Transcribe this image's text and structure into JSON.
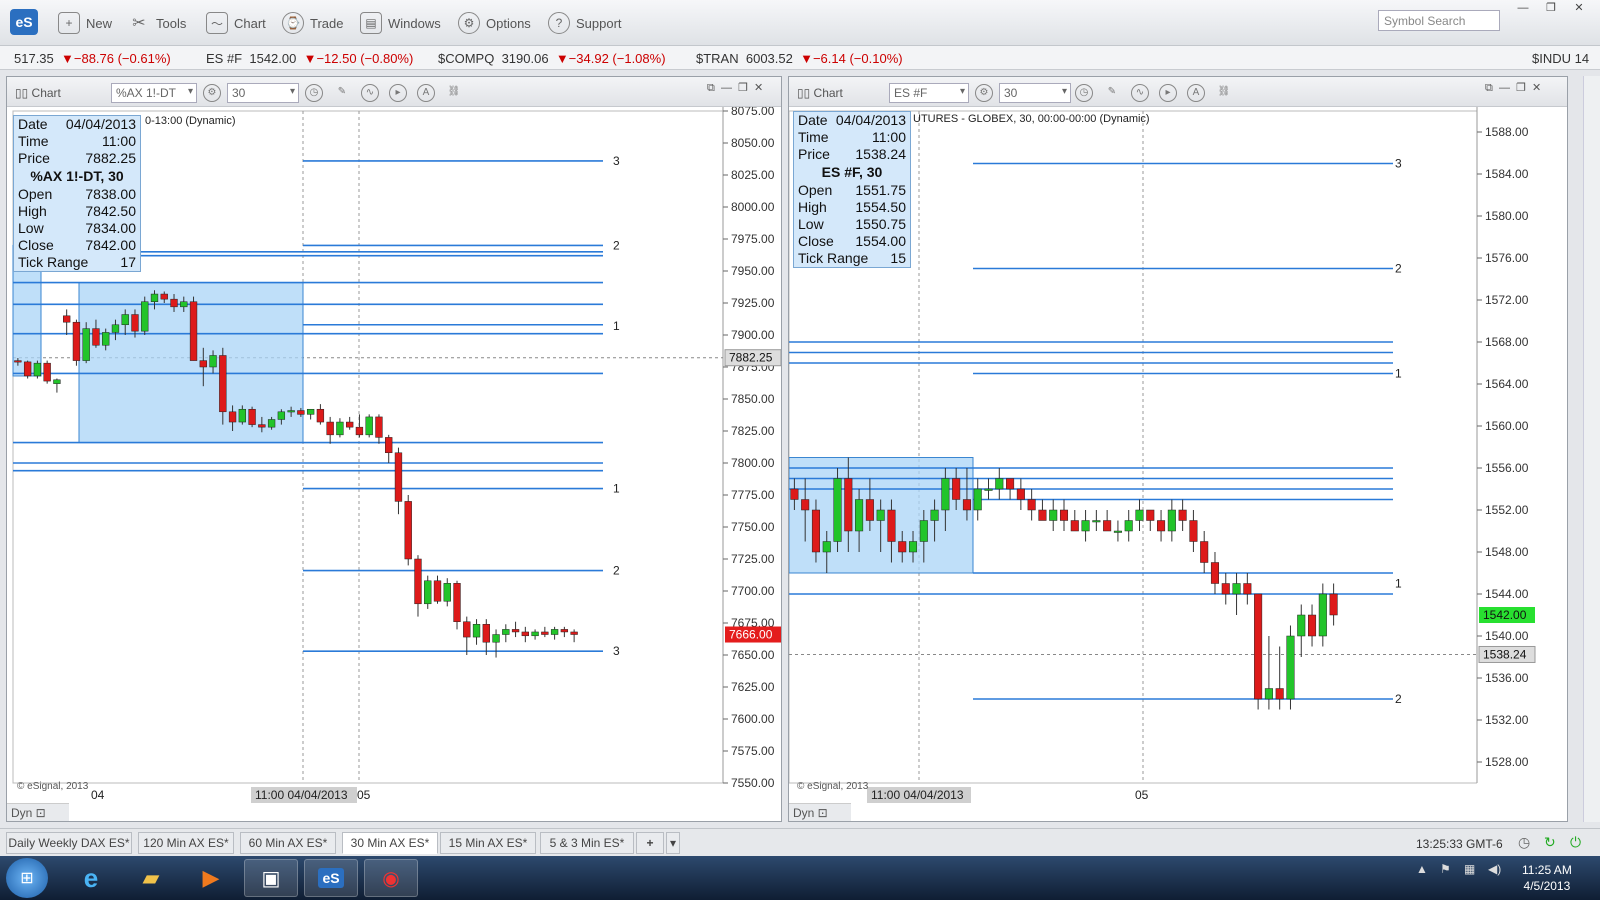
{
  "toolbar": {
    "new": "New",
    "tools": "Tools",
    "chart": "Chart",
    "trade": "Trade",
    "windows": "Windows",
    "options": "Options",
    "support": "Support",
    "search_placeholder": "Symbol Search",
    "logo": "eS"
  },
  "ticker": [
    {
      "sym": "517.35",
      "chg": "▼−88.76 (−0.61%)"
    },
    {
      "sym": "ES #F",
      "price": "1542.00",
      "chg": "▼−12.50 (−0.80%)"
    },
    {
      "sym": "$COMPQ",
      "price": "3190.06",
      "chg": "▼−34.92 (−1.08%)"
    },
    {
      "sym": "$TRAN",
      "price": "6003.52",
      "chg": "▼−6.14 (−0.10%)"
    },
    {
      "sym": "$INDU",
      "price": "14"
    }
  ],
  "left": {
    "label": "Chart",
    "symbol": "%AX 1!-DT",
    "interval": "30",
    "subtitle": "0-13:00 (Dynamic)",
    "box": {
      "date_l": "Date",
      "date": "04/04/2013",
      "time_l": "Time",
      "time": "11:00",
      "price_l": "Price",
      "price": "7882.25",
      "head": "%AX 1!-DT, 30",
      "open_l": "Open",
      "open": "7838.00",
      "high_l": "High",
      "high": "7842.50",
      "low_l": "Low",
      "low": "7834.00",
      "close_l": "Close",
      "close": "7842.00",
      "tr_l": "Tick Range",
      "tr": "17"
    },
    "cursor_price": "7882.25",
    "last_price": "7666.00",
    "dyn": "Dyn",
    "esig": "© eSignal, 2013",
    "xlabels": [
      "04",
      "11:00 04/04/2013",
      "05"
    ]
  },
  "right": {
    "label": "Chart",
    "symbol": "ES #F",
    "interval": "30",
    "subtitle": "UTURES - GLOBEX, 30, 00:00-00:00 (Dynamic)",
    "box": {
      "date_l": "Date",
      "date": "04/04/2013",
      "time_l": "Time",
      "time": "11:00",
      "price_l": "Price",
      "price": "1538.24",
      "head": "ES #F, 30",
      "open_l": "Open",
      "open": "1551.75",
      "high_l": "High",
      "high": "1554.50",
      "low_l": "Low",
      "low": "1550.75",
      "close_l": "Close",
      "close": "1554.00",
      "tr_l": "Tick Range",
      "tr": "15"
    },
    "cursor_price": "1538.24",
    "last_price": "1542.00",
    "dyn": "Dyn",
    "esig": "© eSignal, 2013",
    "xlabels": [
      "11:00 04/04/2013",
      "05"
    ]
  },
  "tabs": [
    "Daily Weekly DAX ES*",
    "120 Min AX ES*",
    "60 Min AX ES*",
    "30 Min AX ES*",
    "15 Min AX ES*",
    "5 & 3 Min ES*"
  ],
  "active_tab": 3,
  "status_clock": "13:25:33 GMT-6",
  "taskbar": {
    "time": "11:25 AM",
    "date": "4/5/2013"
  },
  "chart_data": [
    {
      "type": "candlestick",
      "symbol": "%AX 1!-DT",
      "interval": "30",
      "ylim": [
        7550,
        8075
      ],
      "yticks": [
        8075,
        8050,
        8025,
        8000,
        7975,
        7950,
        7925,
        7900,
        7875,
        7850,
        7825,
        7800,
        7775,
        7750,
        7725,
        7700,
        7675,
        7650,
        7625,
        7600,
        7575,
        7550
      ],
      "candles": [
        [
          7880,
          7882,
          7876,
          7879
        ],
        [
          7879,
          7880,
          7866,
          7868
        ],
        [
          7868,
          7880,
          7866,
          7878
        ],
        [
          7878,
          7880,
          7862,
          7864
        ],
        [
          7862,
          7866,
          7855,
          7865
        ],
        [
          7915,
          7920,
          7900,
          7910
        ],
        [
          7910,
          7912,
          7876,
          7880
        ],
        [
          7880,
          7910,
          7878,
          7905
        ],
        [
          7905,
          7912,
          7890,
          7892
        ],
        [
          7892,
          7905,
          7888,
          7902
        ],
        [
          7902,
          7912,
          7896,
          7908
        ],
        [
          7908,
          7920,
          7900,
          7916
        ],
        [
          7916,
          7920,
          7898,
          7903
        ],
        [
          7903,
          7930,
          7900,
          7926
        ],
        [
          7926,
          7935,
          7920,
          7932
        ],
        [
          7932,
          7934,
          7925,
          7928
        ],
        [
          7928,
          7932,
          7918,
          7922
        ],
        [
          7922,
          7930,
          7918,
          7926
        ],
        [
          7926,
          7930,
          7880,
          7880
        ],
        [
          7880,
          7890,
          7860,
          7875
        ],
        [
          7875,
          7888,
          7870,
          7884
        ],
        [
          7884,
          7890,
          7830,
          7840
        ],
        [
          7840,
          7845,
          7825,
          7832
        ],
        [
          7832,
          7845,
          7830,
          7842
        ],
        [
          7842,
          7844,
          7828,
          7830
        ],
        [
          7830,
          7836,
          7824,
          7828
        ],
        [
          7828,
          7836,
          7826,
          7834
        ],
        [
          7834,
          7842,
          7830,
          7840
        ],
        [
          7840,
          7844,
          7836,
          7841
        ],
        [
          7841,
          7843,
          7836,
          7838
        ],
        [
          7838,
          7842,
          7834,
          7842
        ],
        [
          7842,
          7846,
          7830,
          7832
        ],
        [
          7832,
          7836,
          7815,
          7822
        ],
        [
          7822,
          7835,
          7820,
          7832
        ],
        [
          7832,
          7836,
          7826,
          7828
        ],
        [
          7828,
          7838,
          7820,
          7822
        ],
        [
          7822,
          7838,
          7820,
          7836
        ],
        [
          7836,
          7838,
          7815,
          7820
        ],
        [
          7820,
          7822,
          7800,
          7808
        ],
        [
          7808,
          7812,
          7760,
          7770
        ],
        [
          7770,
          7775,
          7720,
          7725
        ],
        [
          7725,
          7728,
          7680,
          7690
        ],
        [
          7690,
          7712,
          7686,
          7708
        ],
        [
          7708,
          7712,
          7690,
          7692
        ],
        [
          7692,
          7710,
          7688,
          7706
        ],
        [
          7706,
          7708,
          7670,
          7676
        ],
        [
          7676,
          7680,
          7650,
          7664
        ],
        [
          7664,
          7678,
          7658,
          7674
        ],
        [
          7674,
          7678,
          7650,
          7660
        ],
        [
          7660,
          7670,
          7648,
          7666
        ],
        [
          7666,
          7674,
          7660,
          7670
        ],
        [
          7670,
          7676,
          7664,
          7668
        ],
        [
          7668,
          7672,
          7660,
          7665
        ],
        [
          7665,
          7670,
          7662,
          7668
        ],
        [
          7668,
          7672,
          7664,
          7666
        ],
        [
          7666,
          7672,
          7662,
          7670
        ],
        [
          7670,
          7672,
          7664,
          7668
        ],
        [
          7668,
          7670,
          7660,
          7666
        ]
      ],
      "level_labels": [
        {
          "text": "3",
          "price": 8036
        },
        {
          "text": "2",
          "price": 7970
        },
        {
          "text": "1",
          "price": 7907
        },
        {
          "text": "1",
          "price": 7780
        },
        {
          "text": "2",
          "price": 7716
        },
        {
          "text": "3",
          "price": 7653
        }
      ],
      "levels": [
        8036,
        7970,
        7965,
        7962,
        7941,
        7924,
        7908,
        7901,
        7870,
        7816,
        7800,
        7794,
        7780,
        7716,
        7653
      ]
    },
    {
      "type": "candlestick",
      "symbol": "ES #F",
      "interval": "30",
      "ylim": [
        1526,
        1590
      ],
      "yticks": [
        1588,
        1584,
        1580,
        1576,
        1572,
        1568,
        1564,
        1560,
        1556,
        1552,
        1548,
        1544,
        1540,
        1536,
        1532,
        1528
      ],
      "candles": [
        [
          1554,
          1555,
          1552,
          1553
        ],
        [
          1553,
          1555,
          1549,
          1552
        ],
        [
          1552,
          1553,
          1547,
          1548
        ],
        [
          1548,
          1550,
          1546,
          1549
        ],
        [
          1549,
          1556,
          1548,
          1555
        ],
        [
          1555,
          1557,
          1548,
          1550
        ],
        [
          1550,
          1554,
          1548,
          1553
        ],
        [
          1553,
          1555,
          1550,
          1551
        ],
        [
          1551,
          1553,
          1548,
          1552
        ],
        [
          1552,
          1553,
          1547,
          1549
        ],
        [
          1549,
          1550,
          1547,
          1548
        ],
        [
          1548,
          1550,
          1547,
          1549
        ],
        [
          1549,
          1552,
          1547,
          1551
        ],
        [
          1551,
          1553,
          1549,
          1552
        ],
        [
          1552,
          1556,
          1550,
          1555
        ],
        [
          1555,
          1556,
          1552,
          1553
        ],
        [
          1553,
          1556,
          1551,
          1552
        ],
        [
          1552,
          1555,
          1551,
          1554
        ],
        [
          1554,
          1555,
          1553,
          1554
        ],
        [
          1554,
          1556,
          1553,
          1555
        ],
        [
          1555,
          1555,
          1553,
          1554
        ],
        [
          1554,
          1555,
          1552,
          1553
        ],
        [
          1553,
          1554,
          1551,
          1552
        ],
        [
          1552,
          1553,
          1551,
          1551
        ],
        [
          1551,
          1553,
          1550,
          1552
        ],
        [
          1552,
          1553,
          1550,
          1551
        ],
        [
          1551,
          1552,
          1550,
          1550
        ],
        [
          1550,
          1552,
          1549,
          1551
        ],
        [
          1551,
          1552,
          1550,
          1551
        ],
        [
          1551,
          1552,
          1550,
          1550
        ],
        [
          1550,
          1551,
          1549,
          1550
        ],
        [
          1550,
          1552,
          1549,
          1551
        ],
        [
          1551,
          1553,
          1550,
          1552
        ],
        [
          1552,
          1552,
          1550,
          1551
        ],
        [
          1551,
          1552,
          1549,
          1550
        ],
        [
          1550,
          1553,
          1549,
          1552
        ],
        [
          1552,
          1553,
          1550,
          1551
        ],
        [
          1551,
          1552,
          1548,
          1549
        ],
        [
          1549,
          1550,
          1546,
          1547
        ],
        [
          1547,
          1548,
          1544,
          1545
        ],
        [
          1545,
          1546,
          1543,
          1544
        ],
        [
          1544,
          1546,
          1542,
          1545
        ],
        [
          1545,
          1546,
          1543,
          1544
        ],
        [
          1544,
          1544,
          1533,
          1534
        ],
        [
          1534,
          1540,
          1533,
          1535
        ],
        [
          1535,
          1539,
          1533,
          1534
        ],
        [
          1534,
          1541,
          1533,
          1540
        ],
        [
          1540,
          1543,
          1538,
          1542
        ],
        [
          1542,
          1543,
          1539,
          1540
        ],
        [
          1540,
          1545,
          1539,
          1544
        ],
        [
          1544,
          1545,
          1541,
          1542
        ]
      ],
      "level_labels": [
        {
          "text": "3",
          "price": 1585
        },
        {
          "text": "2",
          "price": 1575
        },
        {
          "text": "1",
          "price": 1565
        },
        {
          "text": "1",
          "price": 1545
        },
        {
          "text": "2",
          "price": 1534
        }
      ],
      "levels": [
        1585,
        1575,
        1568,
        1567,
        1566,
        1565,
        1556,
        1555,
        1554,
        1553,
        1546,
        1544,
        1534
      ]
    }
  ]
}
